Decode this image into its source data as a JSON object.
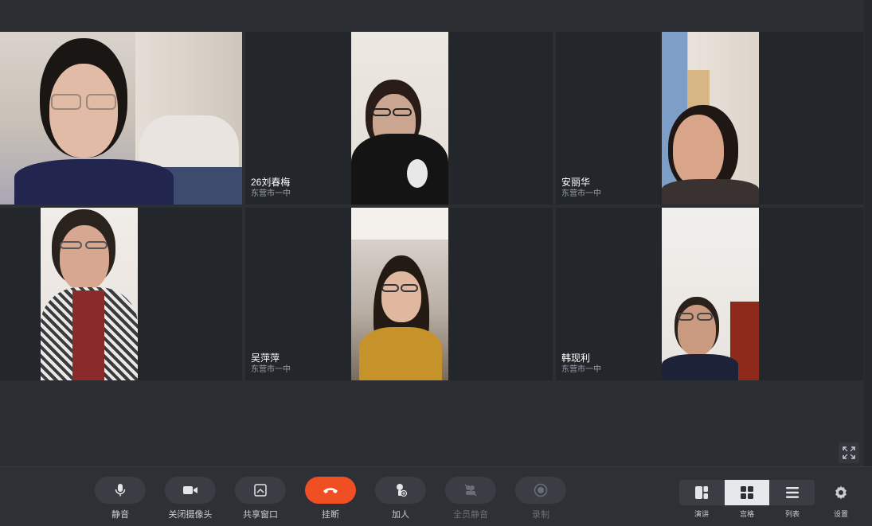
{
  "participants": [
    {
      "name": "",
      "org": ""
    },
    {
      "name": "26刘春梅",
      "org": "东营市一中"
    },
    {
      "name": "安丽华",
      "org": "东营市一中"
    },
    {
      "name": "",
      "org": ""
    },
    {
      "name": "吴萍萍",
      "org": "东营市一中"
    },
    {
      "name": "韩现利",
      "org": "东营市一中"
    }
  ],
  "toolbar": {
    "mute_label": "静音",
    "camera_label": "关闭摄像头",
    "share_label": "共享窗口",
    "hangup_label": "挂断",
    "add_label": "加人",
    "mute_all_label": "全员静音",
    "record_label": "录制"
  },
  "views": {
    "speaker_label": "演讲",
    "grid_label": "宫格",
    "list_label": "列表",
    "active": "宫格"
  },
  "settings_label": "设置",
  "colors": {
    "hangup": "#f04f24",
    "background": "#2b2e33",
    "tile": "#23262b"
  }
}
